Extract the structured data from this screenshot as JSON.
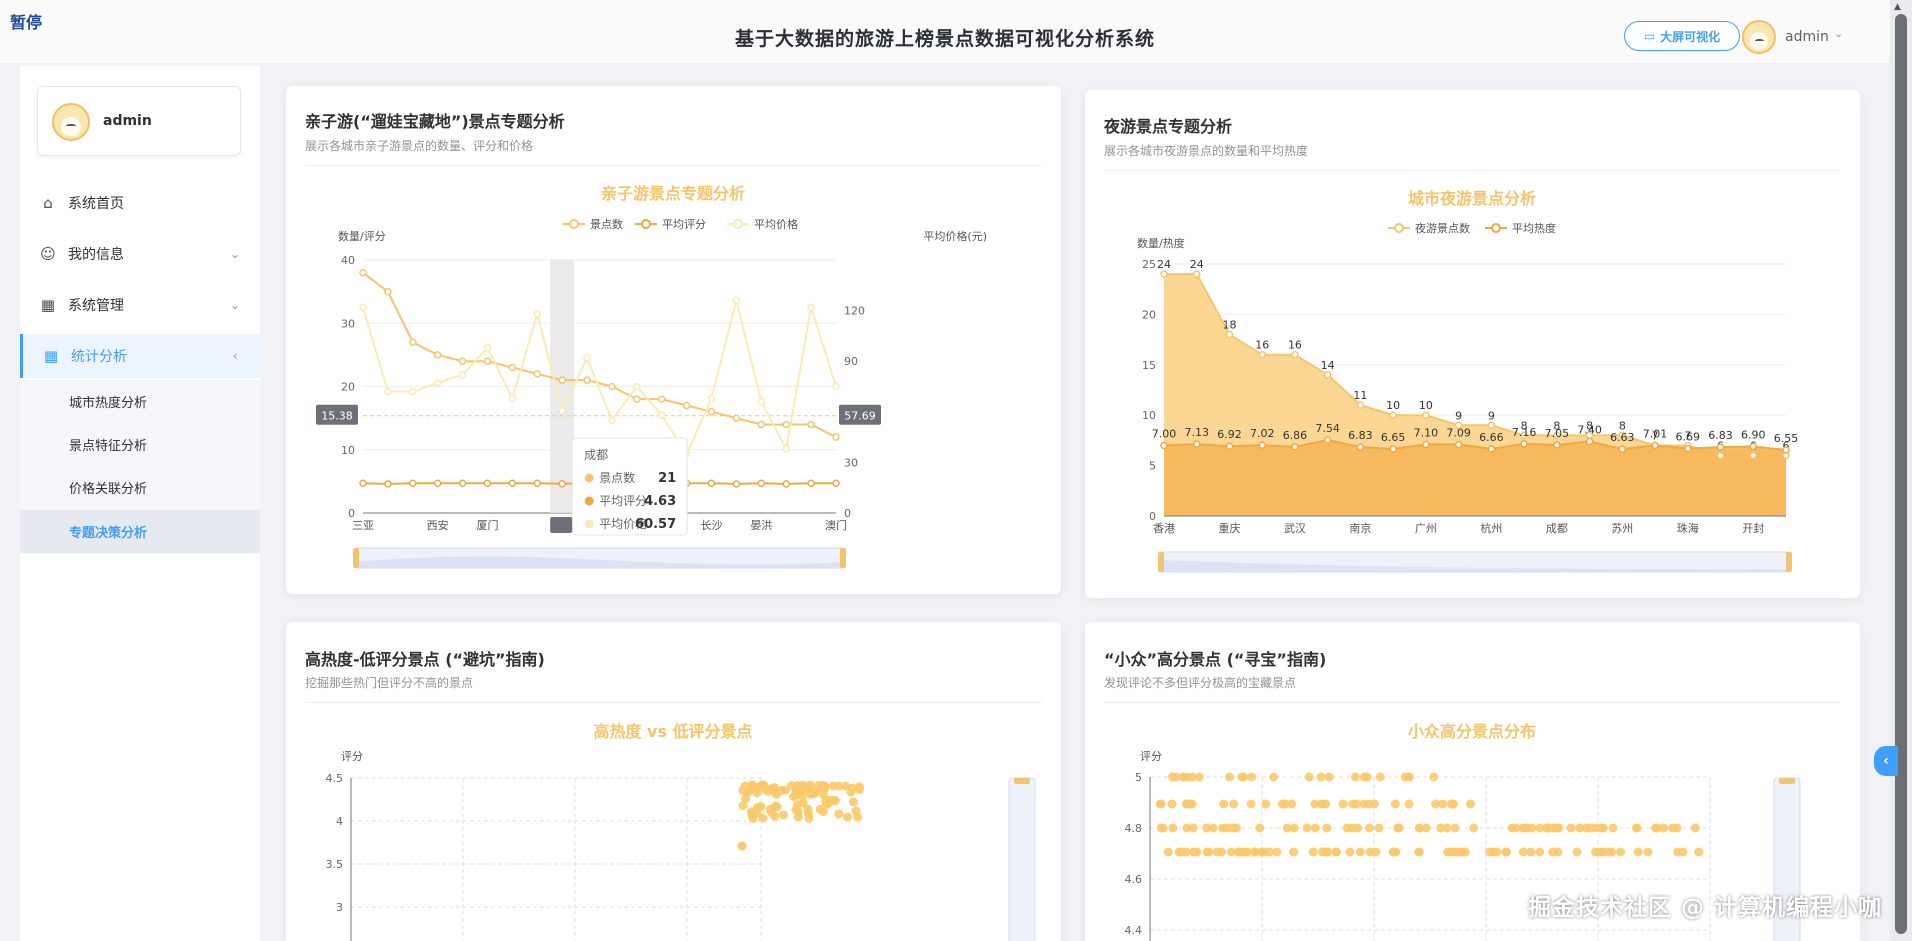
{
  "app": {
    "title": "基于大数据的旅游上榜景点数据可视化分析系统",
    "pause_label": "暂停",
    "bigscreen_label": "大屏可视化",
    "user": "admin",
    "watermark": "掘金技术社区 @ 计算机编程小咖"
  },
  "colors": {
    "accent": "#409eff",
    "series_gold": "#f7c46c",
    "series_orange": "#f0a845",
    "series_light": "#fbeab4"
  },
  "sidebar": {
    "username": "admin",
    "items": [
      {
        "label": "系统首页",
        "icon": "home-icon"
      },
      {
        "label": "我的信息",
        "icon": "user-icon"
      },
      {
        "label": "系统管理",
        "icon": "grid-icon"
      },
      {
        "label": "统计分析",
        "icon": "grid-icon"
      }
    ],
    "sub_items": [
      "城市热度分析",
      "景点特征分析",
      "价格关联分析",
      "专题决策分析"
    ]
  },
  "cards": [
    {
      "title": "亲子游(“遛娃宝藏地”)景点专题分析",
      "subtitle": "展示各城市亲子游景点的数量、评分和价格"
    },
    {
      "title": "夜游景点专题分析",
      "subtitle": "展示各城市夜游景点的数量和平均热度"
    },
    {
      "title": "高热度-低评分景点 (“避坑”指南)",
      "subtitle": "挖掘那些热门但评分不高的景点"
    },
    {
      "title": "“小众”高分景点 (“寻宝”指南)",
      "subtitle": "发现评论不多但评分极高的宝藏景点"
    }
  ],
  "chart_data": [
    {
      "type": "line",
      "title": "亲子游景点专题分析",
      "ylabel": "数量/评分",
      "y2label": "平均价格(元)",
      "ylim": [
        0,
        40
      ],
      "y2lim": [
        0,
        150
      ],
      "tick_labels": [
        "三亚",
        "西安",
        "厦门",
        "杭州",
        "成都",
        "长沙",
        "晏洪",
        "澳门"
      ],
      "series": [
        {
          "name": "景点数",
          "axis": "left",
          "values": [
            38,
            35,
            27,
            25,
            24,
            24,
            23,
            22,
            21,
            21,
            20,
            18,
            18,
            17,
            16,
            15,
            14,
            14,
            14,
            12
          ]
        },
        {
          "name": "平均评分",
          "axis": "left",
          "values": [
            4.7,
            4.6,
            4.7,
            4.7,
            4.7,
            4.7,
            4.7,
            4.7,
            4.63,
            4.7,
            4.7,
            4.7,
            4.7,
            4.7,
            4.7,
            4.6,
            4.7,
            4.6,
            4.7,
            4.7
          ]
        },
        {
          "name": "平均价格",
          "axis": "right",
          "values": [
            122,
            72,
            72,
            77,
            82,
            98,
            68,
            118,
            60.57,
            92,
            55,
            75,
            58,
            35,
            68,
            126,
            66,
            38,
            122,
            75
          ]
        }
      ],
      "markline_left": "15.38",
      "markline_right": "57.69",
      "tooltip": {
        "title": "成都",
        "rows": [
          {
            "label": "景点数",
            "value": "21"
          },
          {
            "label": "平均评分",
            "value": "4.63"
          },
          {
            "label": "平均价格",
            "value": "60.57"
          }
        ]
      },
      "legend": "top",
      "grid": true
    },
    {
      "type": "area",
      "title": "城市夜游景点分析",
      "ylabel": "数量/热度",
      "ylim": [
        0,
        25
      ],
      "categories": [
        "香港",
        "",
        "重庆",
        "",
        "武汉",
        "",
        "南京",
        "",
        "广州",
        "",
        "杭州",
        "",
        "成都",
        "",
        "苏州",
        "",
        "珠海",
        "",
        "开封",
        ""
      ],
      "series": [
        {
          "name": "夜游景点数",
          "values": [
            24,
            24,
            18,
            16,
            16,
            14,
            11,
            10,
            10,
            9,
            9,
            8,
            8,
            8,
            8,
            7,
            7,
            6,
            6,
            6
          ]
        },
        {
          "name": "平均热度",
          "values": [
            7.0,
            7.13,
            6.92,
            7.02,
            6.86,
            7.54,
            6.83,
            6.65,
            7.1,
            7.09,
            6.66,
            7.16,
            7.05,
            7.4,
            6.63,
            7.01,
            6.69,
            6.83,
            6.9,
            6.55
          ]
        }
      ],
      "legend": "top",
      "grid": true
    },
    {
      "type": "scatter",
      "title": "高热度 vs 低评分景点",
      "ylabel": "评分",
      "ylim": [
        2.5,
        4.5
      ],
      "yticks": [
        "4.5",
        "4",
        "3.5",
        "3"
      ],
      "grid": true
    },
    {
      "type": "scatter",
      "title": "小众高分景点分布",
      "ylabel": "评分",
      "ylim": [
        4.4,
        5
      ],
      "yticks": [
        "5",
        "4.8",
        "4.6",
        "4.4"
      ],
      "grid": true
    }
  ]
}
